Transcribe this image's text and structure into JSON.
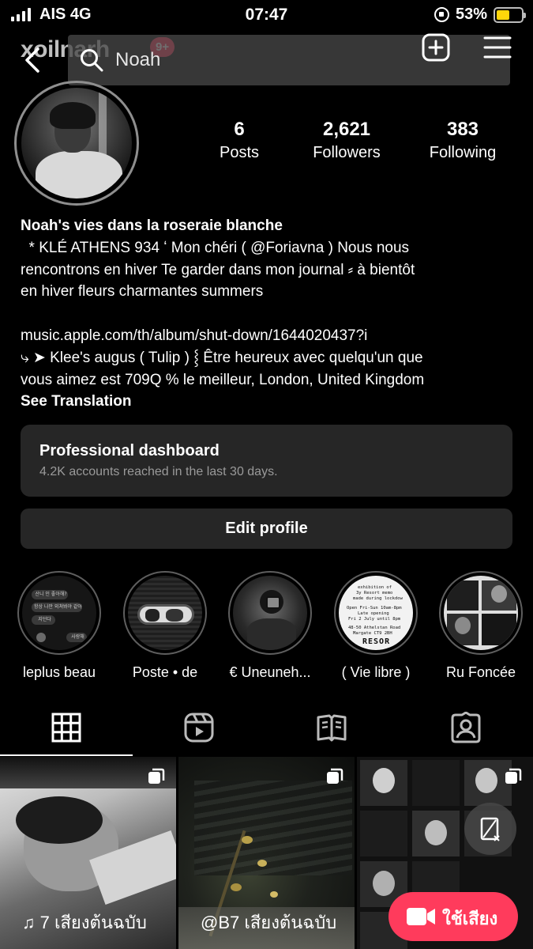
{
  "status_bar": {
    "carrier": "AIS 4G",
    "time": "07:47",
    "battery": "53%",
    "battery_level": 0.53,
    "battery_color": "#ffd60a"
  },
  "top_bar": {
    "username": "xoilnarh",
    "notification_badge": "9+",
    "search_value": "Noah"
  },
  "profile": {
    "stats": [
      {
        "value": "6",
        "label": "Posts"
      },
      {
        "value": "2,621",
        "label": "Followers"
      },
      {
        "value": "383",
        "label": "Following"
      }
    ],
    "bio": {
      "name": "Noah's vies dans la roseraie blanche",
      "line1": "  * KLÉ ATHENS 934 ʻ Mon chéri ( @Foriavna ) Nous nous",
      "line2": "rencontrons en hiver Te garder dans mon journal ⸗ à bientôt",
      "line3": "en hiver fleurs charmantes summers",
      "link": "music.apple.com/th/album/shut-down/1644020437?i",
      "line4": "⤷ ➤ Klee's augus ( Tulip ) ⸾ Être heureux avec quelqu'un que",
      "line5": "vous aimez est 709Q % le meilleur, London, United Kingdom",
      "see_translation": "See Translation"
    }
  },
  "dashboard": {
    "title": "Professional dashboard",
    "subtitle": "4.2K accounts reached in the last 30 days."
  },
  "edit_profile_label": "Edit profile",
  "highlights": [
    {
      "label": "leplus beau",
      "icon": "chat-screenshot"
    },
    {
      "label": "Poste • de",
      "icon": "window-photo"
    },
    {
      "label": "€ Uneuneh...",
      "icon": "camera-portrait"
    },
    {
      "label": "( Vie libre )",
      "icon": "poster-text"
    },
    {
      "label": "Ru Foncée",
      "icon": "photo-strip"
    }
  ],
  "highlight_texts": {
    "h1a": "산니 인 좋아해?",
    "h1b": "항상 나만 외쳐봐야 같아",
    "h1c": "지던다",
    "h1d": "사랑해",
    "h4a": "exhibition of",
    "h4b": "3y Resort memo",
    "h4c": "made during lockdow",
    "h4d": "Open Fri-Sun 10am-8pm",
    "h4e": "Late opening",
    "h4f": "Fri 2 July until 8pm",
    "h4g": "48-50 Athelstan Road",
    "h4h": "Margate CT9 2BH",
    "h4i": "RESOR"
  },
  "tabs": [
    {
      "name": "posts-grid",
      "icon": "grid-icon",
      "active": true
    },
    {
      "name": "reels",
      "icon": "reels-icon",
      "active": false
    },
    {
      "name": "guides",
      "icon": "book-icon",
      "active": false
    },
    {
      "name": "tagged",
      "icon": "tagged-person-icon",
      "active": false
    }
  ],
  "grid": {
    "captions": [
      "♫ 7 เสียงต้นฉบับ",
      "@B7 เสียงต้นฉบับ"
    ],
    "camera_button_label": "ใช้เสียง",
    "accent_color": "#ff3b5c"
  }
}
